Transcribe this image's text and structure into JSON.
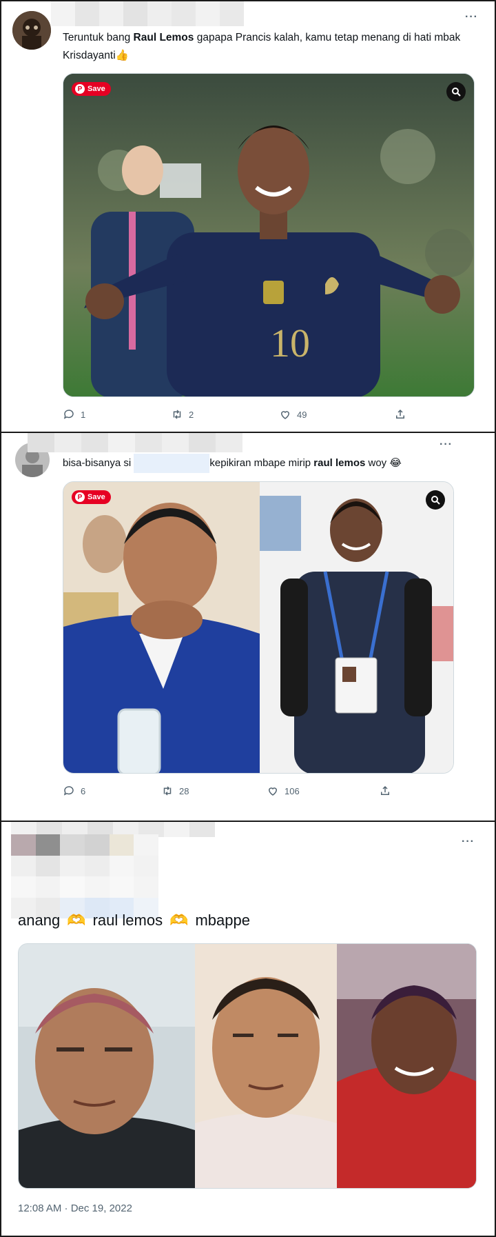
{
  "tweets": [
    {
      "text_parts": [
        "Teruntuk bang ",
        "Raul Lemos",
        " gapapa Prancis kalah, kamu tetap menang di hati mbak Krisdayanti",
        "👍"
      ],
      "media_badge": "Save",
      "replies": "1",
      "retweets": "2",
      "likes": "49"
    },
    {
      "text_parts": [
        "bisa-bisanya si ",
        "kepikiran mbape mirip ",
        "raul lemos",
        " woy ",
        "😂"
      ],
      "media_badge": "Save",
      "replies": "6",
      "retweets": "28",
      "likes": "106"
    },
    {
      "text_parts": [
        "anang",
        "raul lemos",
        "mbappe"
      ],
      "hand_emoji": "🫶",
      "timestamp": "12:08 AM · Dec 19, 2022"
    }
  ],
  "icons": {
    "more": "more-icon",
    "reply": "reply-icon",
    "retweet": "retweet-icon",
    "like": "heart-icon",
    "share": "share-icon",
    "lens": "lens-icon"
  },
  "colors": {
    "accent": "#e60023",
    "muted": "#536471",
    "jersey": "#1c2a55"
  }
}
